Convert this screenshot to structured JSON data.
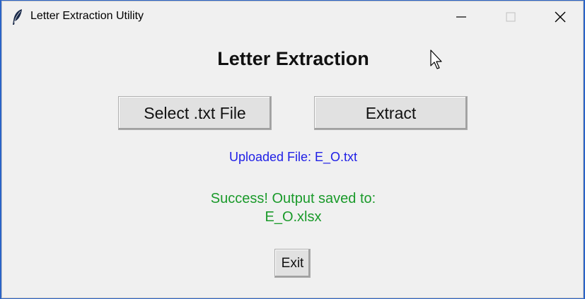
{
  "window": {
    "title": "Letter Extraction Utility",
    "icon": "feather-icon",
    "controls": [
      "minimize-icon",
      "maximize-icon",
      "close-icon"
    ]
  },
  "main": {
    "heading": "Letter Extraction",
    "select_button_label": "Select .txt File",
    "extract_button_label": "Extract",
    "uploaded_text": "Uploaded File: E_O.txt",
    "success_line1": "Success! Output saved to:",
    "success_line2": "E_O.xlsx",
    "exit_button_label": "Exit"
  },
  "colors": {
    "window_bg": "#f0f0f0",
    "uploaded_text": "#2020e6",
    "success_text": "#1a9a2a",
    "desktop_bg": "#2a63c7"
  }
}
